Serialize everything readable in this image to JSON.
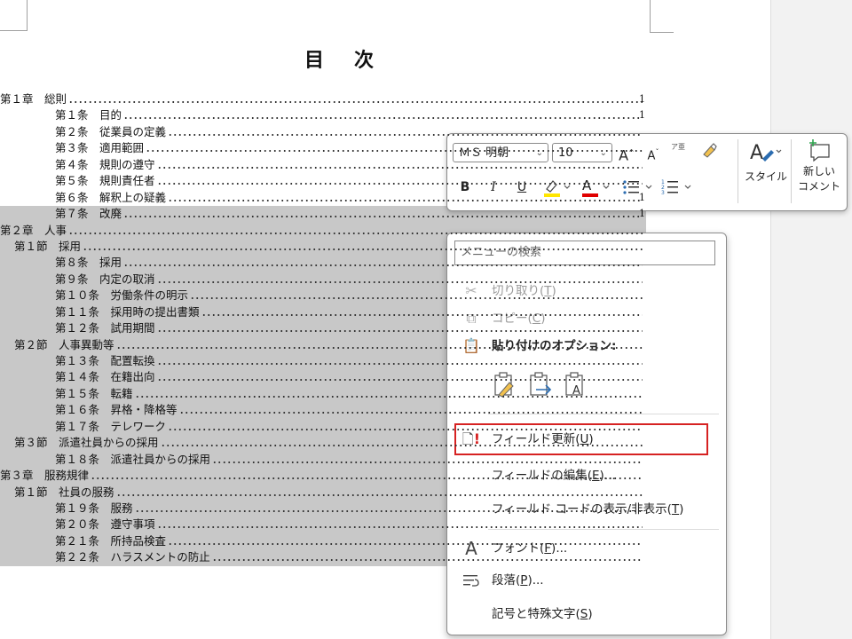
{
  "document": {
    "title": "目　次",
    "toc": [
      {
        "text": "第１章　総則",
        "indent": 0,
        "page": "1",
        "sel": false
      },
      {
        "text": "第１条　目的",
        "indent": 2,
        "page": "1",
        "sel": false
      },
      {
        "text": "第２条　従業員の定義",
        "indent": 2,
        "page": "",
        "sel": false
      },
      {
        "text": "第３条　適用範囲",
        "indent": 2,
        "page": "",
        "sel": false
      },
      {
        "text": "第４条　規則の遵守",
        "indent": 2,
        "page": "",
        "sel": false
      },
      {
        "text": "第５条　規則責任者",
        "indent": 2,
        "page": "",
        "sel": false
      },
      {
        "text": "第６条　解釈上の疑義",
        "indent": 2,
        "page": "1",
        "sel": false
      },
      {
        "text": "第７条　改廃",
        "indent": 2,
        "page": "1",
        "sel": true
      },
      {
        "text": "第２章　人事",
        "indent": 0,
        "page": "",
        "sel": true
      },
      {
        "text": "第１節　採用",
        "indent": 1,
        "page": "",
        "sel": true
      },
      {
        "text": "第８条　採用",
        "indent": 2,
        "page": "",
        "sel": true
      },
      {
        "text": "第９条　内定の取消",
        "indent": 2,
        "page": "",
        "sel": true
      },
      {
        "text": "第１０条　労働条件の明示",
        "indent": 2,
        "page": "",
        "sel": true
      },
      {
        "text": "第１１条　採用時の提出書類",
        "indent": 2,
        "page": "",
        "sel": true
      },
      {
        "text": "第１２条　試用期間",
        "indent": 2,
        "page": "",
        "sel": true
      },
      {
        "text": "第２節　人事異動等",
        "indent": 1,
        "page": "",
        "sel": true
      },
      {
        "text": "第１３条　配置転換",
        "indent": 2,
        "page": "",
        "sel": true
      },
      {
        "text": "第１４条　在籍出向",
        "indent": 2,
        "page": "",
        "sel": true
      },
      {
        "text": "第１５条　転籍",
        "indent": 2,
        "page": "",
        "sel": true
      },
      {
        "text": "第１６条　昇格・降格等",
        "indent": 2,
        "page": "",
        "sel": true
      },
      {
        "text": "第１７条　テレワーク",
        "indent": 2,
        "page": "",
        "sel": true
      },
      {
        "text": "第３節　派遣社員からの採用",
        "indent": 1,
        "page": "",
        "sel": true
      },
      {
        "text": "第１８条　派遣社員からの採用",
        "indent": 2,
        "page": "",
        "sel": true
      },
      {
        "text": "第３章　服務規律",
        "indent": 0,
        "page": "",
        "sel": true
      },
      {
        "text": "第１節　社員の服務",
        "indent": 1,
        "page": "",
        "sel": true
      },
      {
        "text": "第１９条　服務",
        "indent": 2,
        "page": "",
        "sel": true
      },
      {
        "text": "第２０条　遵守事項",
        "indent": 2,
        "page": "",
        "sel": true
      },
      {
        "text": "第２１条　所持品検査",
        "indent": 2,
        "page": "",
        "sel": true
      },
      {
        "text": "第２２条　ハラスメントの防止",
        "indent": 2,
        "page": "",
        "sel": true
      }
    ]
  },
  "mini_toolbar": {
    "font_name": "ＭＳ 明朝",
    "font_size": "10",
    "grow_font": "A",
    "shrink_font": "A",
    "phonetic": "ア亜",
    "bold": "B",
    "italic": "I",
    "underline": "U",
    "font_color": "A",
    "styles_label": "スタイル",
    "new_comment_label_1": "新しい",
    "new_comment_label_2": "コメント",
    "highlight_color": "#ffe600",
    "font_color_value": "#e00000"
  },
  "context_menu": {
    "search_placeholder": "メニューの検索",
    "cut": "切り取り",
    "cut_key": "T",
    "copy": "コピー",
    "copy_key": "C",
    "paste_options": "貼り付けのオプション:",
    "update_field": "フィールド更新",
    "update_field_key": "U",
    "edit_field": "フィールドの編集",
    "edit_field_key": "E",
    "toggle_codes": "フィールド コードの表示/非表示",
    "toggle_codes_key": "T",
    "font": "フォント",
    "font_key": "F",
    "paragraph": "段落",
    "paragraph_key": "P",
    "symbols": "記号と特殊文字",
    "symbols_key": "S"
  }
}
